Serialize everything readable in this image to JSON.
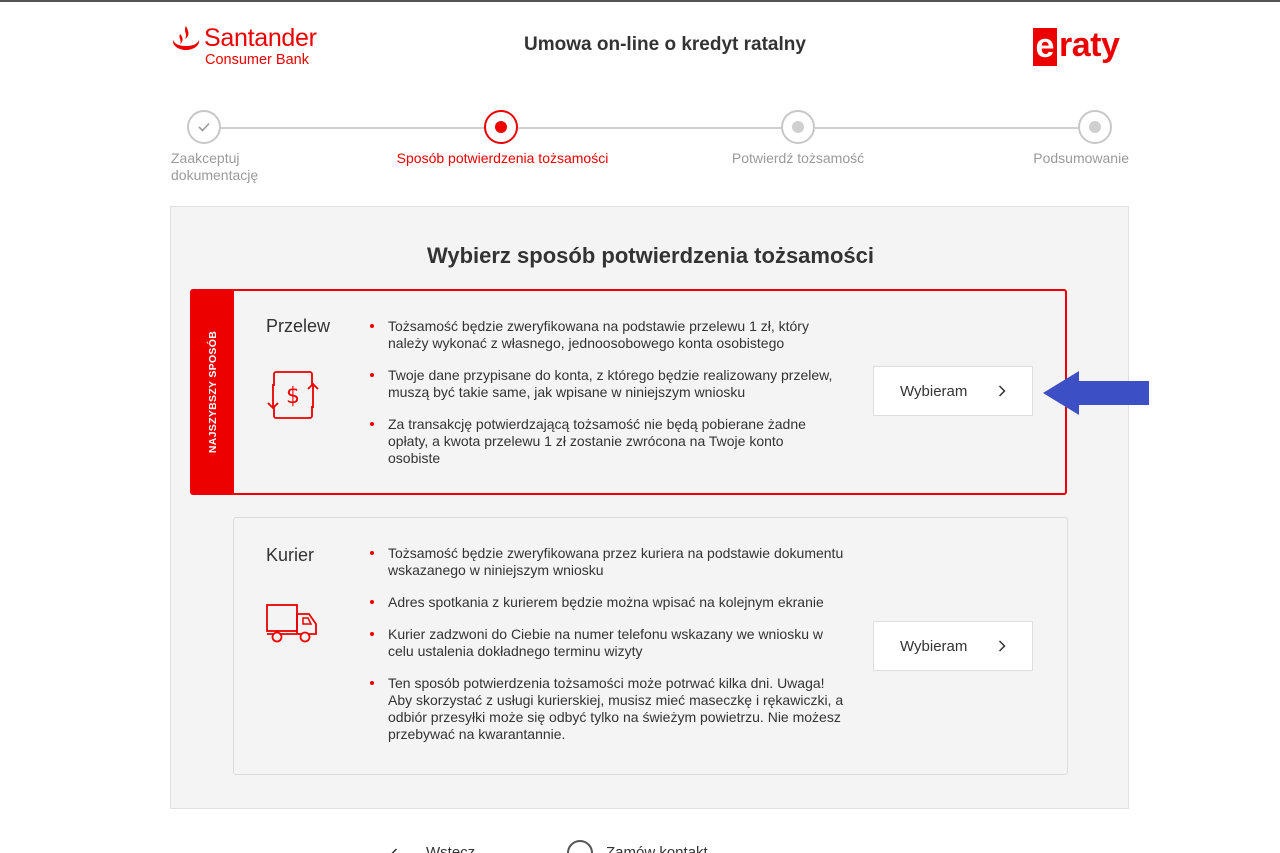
{
  "header": {
    "bank_name": "Santander",
    "bank_subname": "Consumer Bank",
    "title": "Umowa on-line o kredyt ratalny",
    "eraty_first": "e",
    "eraty_rest": "raty"
  },
  "steps": [
    {
      "label": "Zaakceptuj dokumentację",
      "state": "done"
    },
    {
      "label": "Sposób potwierdzenia tożsamości",
      "state": "active"
    },
    {
      "label": "Potwierdź tożsamość",
      "state": "pending"
    },
    {
      "label": "Podsumowanie",
      "state": "pending"
    }
  ],
  "panel": {
    "title": "Wybierz sposób potwierdzenia tożsamości"
  },
  "options": [
    {
      "badge": "NAJSZYBSZY SPOSÓB",
      "title": "Przelew",
      "icon": "dollar-transfer-icon",
      "bullets": [
        "Tożsamość będzie zweryfikowana na podstawie przelewu 1 zł, który należy wykonać z własnego, jednoosobowego konta osobistego",
        "Twoje dane przypisane do konta, z którego będzie realizowany przelew, muszą być takie same, jak wpisane w niniejszym wniosku",
        "Za transakcję potwierdzającą tożsamość nie będą pobierane żadne opłaty, a kwota przelewu 1 zł zostanie zwrócona na Twoje konto osobiste"
      ],
      "button_label": "Wybieram"
    },
    {
      "title": "Kurier",
      "icon": "delivery-truck-icon",
      "bullets": [
        "Tożsamość będzie zweryfikowana przez kuriera na podstawie dokumentu wskazanego w niniejszym wniosku",
        "Adres spotkania z kurierem będzie można wpisać na kolejnym ekranie",
        "Kurier zadzwoni do Ciebie na numer telefonu wskazany we wniosku w celu ustalenia dokładnego terminu wizyty",
        "Ten sposób potwierdzenia tożsamości może potrwać kilka dni. Uwaga! Aby skorzystać z usługi kurierskiej, musisz mieć maseczkę i rękawiczki, a odbiór przesyłki może się odbyć tylko na świeżym powietrzu. Nie możesz przebywać na kwarantannie."
      ],
      "button_label": "Wybieram"
    }
  ],
  "footer": {
    "back_label": "Wstecz",
    "contact_label": "Zamów kontakt"
  },
  "colors": {
    "brand_red": "#ec0000",
    "annotation_arrow": "#3d4fc4"
  }
}
